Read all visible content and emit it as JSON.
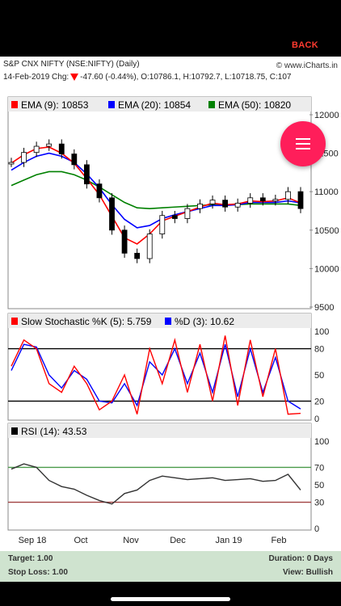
{
  "nav": {
    "back_label": "BACK"
  },
  "header": {
    "symbol_line": "S&P CNX NIFTY (NSE:NIFTY) (Daily)",
    "quote_line": "14-Feb-2019 Chg:",
    "change": "-47.60 (-0.44%)",
    "ohlc": ", O:10786.1, H:10792.7, L:10718.75, C:107",
    "site": "© www.iCharts.in"
  },
  "menu_icon": "hamburger-menu-icon",
  "panels": {
    "price": {
      "legend": [
        {
          "label": "EMA (9): 10853",
          "color": "#ff0000"
        },
        {
          "label": "EMA (20): 10854",
          "color": "#0000ff"
        },
        {
          "label": "EMA (50): 10820",
          "color": "#008000"
        }
      ],
      "y_ticks": [
        "12000",
        "11500",
        "11000",
        "10500",
        "10000",
        "9500"
      ]
    },
    "stochastic": {
      "legend": [
        {
          "label": "Slow Stochastic %K (5): 5.759",
          "color": "#ff0000"
        },
        {
          "label": "%D (3): 10.62",
          "color": "#0000ff"
        }
      ],
      "y_ticks": [
        "100",
        "80",
        "50",
        "20",
        "0"
      ]
    },
    "rsi": {
      "legend": [
        {
          "label": "RSI (14): 43.53",
          "color": "#000000"
        }
      ],
      "y_ticks": [
        "100",
        "70",
        "50",
        "30",
        "0"
      ]
    }
  },
  "x_axis": [
    "Sep 18",
    "Oct",
    "Nov",
    "Dec",
    "Jan 19",
    "Feb"
  ],
  "footer": {
    "target": "Target: 1.00",
    "stop_loss": "Stop Loss: 1.00",
    "duration": "Duration: 0 Days",
    "view": "View: Bullish"
  },
  "chart_data": {
    "type": "line",
    "x": [
      "Sep 18",
      "Sep 18",
      "Sep 18",
      "Sep 18",
      "Sep 18",
      "Oct",
      "Oct",
      "Oct",
      "Oct",
      "Nov",
      "Nov",
      "Nov",
      "Nov",
      "Dec",
      "Dec",
      "Dec",
      "Dec",
      "Jan 19",
      "Jan 19",
      "Jan 19",
      "Jan 19",
      "Feb",
      "Feb",
      "Feb"
    ],
    "series": [
      {
        "name": "Close",
        "values": [
          11380,
          11510,
          11590,
          11620,
          11490,
          11350,
          11100,
          10920,
          10500,
          10200,
          10130,
          10450,
          10690,
          10650,
          10780,
          10840,
          10890,
          10800,
          10850,
          10920,
          10880,
          10900,
          11000,
          10780
        ]
      },
      {
        "name": "EMA (9)",
        "values": [
          11370,
          11480,
          11560,
          11580,
          11500,
          11370,
          11170,
          10960,
          10680,
          10400,
          10320,
          10450,
          10620,
          10680,
          10740,
          10800,
          10850,
          10830,
          10840,
          10880,
          10870,
          10880,
          10920,
          10853
        ]
      },
      {
        "name": "EMA (20)",
        "values": [
          11280,
          11380,
          11460,
          11500,
          11460,
          11380,
          11230,
          11050,
          10830,
          10640,
          10530,
          10560,
          10650,
          10700,
          10740,
          10780,
          10820,
          10820,
          10830,
          10860,
          10860,
          10860,
          10880,
          10854
        ]
      },
      {
        "name": "EMA (50)",
        "values": [
          11080,
          11150,
          11220,
          11260,
          11260,
          11220,
          11150,
          11060,
          10960,
          10860,
          10790,
          10780,
          10790,
          10800,
          10810,
          10820,
          10830,
          10830,
          10830,
          10840,
          10840,
          10840,
          10840,
          10820
        ]
      }
    ],
    "indicators": {
      "stochastic_k": [
        60,
        90,
        80,
        40,
        30,
        60,
        40,
        10,
        20,
        50,
        5,
        80,
        40,
        90,
        30,
        85,
        20,
        95,
        15,
        90,
        25,
        80,
        5,
        6
      ],
      "stochastic_d": [
        55,
        85,
        82,
        50,
        35,
        55,
        45,
        20,
        18,
        40,
        15,
        65,
        50,
        80,
        40,
        75,
        30,
        85,
        25,
        80,
        30,
        70,
        20,
        11
      ],
      "rsi": [
        68,
        74,
        70,
        55,
        48,
        45,
        38,
        32,
        28,
        40,
        44,
        55,
        60,
        58,
        56,
        57,
        58,
        55,
        56,
        57,
        54,
        55,
        62,
        44
      ]
    },
    "ylim": [
      9500,
      12000
    ],
    "legend": "top"
  }
}
